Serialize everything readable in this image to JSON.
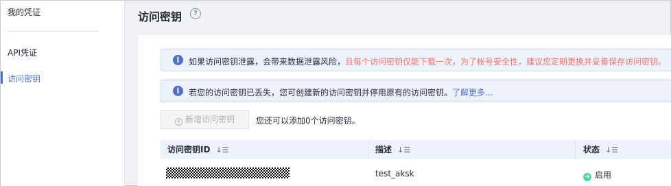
{
  "sidebar": {
    "title": "我的凭证",
    "items": [
      {
        "label": "API凭证"
      },
      {
        "label": "访问密钥"
      }
    ]
  },
  "header": {
    "title": "访问密钥",
    "help_glyph": "?"
  },
  "notices": [
    {
      "text_normal": "如果访问密钥泄露，会带来数据泄露风险，",
      "text_warning": "且每个访问密钥仅能下载一次，为了帐号安全性，建议您定期更换并妥善保存访问密钥。"
    },
    {
      "text_normal": "若您的访问密钥已丢失，您可创建新的访问密钥并停用原有的访问密钥。",
      "link": "了解更多..."
    }
  ],
  "toolbar": {
    "add_label": "新增访问密钥",
    "quota_text": "您还可以添加0个访问密钥。"
  },
  "table": {
    "columns": [
      {
        "label": "访问密钥ID"
      },
      {
        "label": "描述"
      },
      {
        "label": "状态"
      }
    ],
    "rows": [
      {
        "description": "test_aksk",
        "status": "启用"
      }
    ]
  },
  "icons": {
    "info": "info-icon",
    "sort": "sort-icon",
    "help": "question-circle-icon",
    "add": "plus-circle-icon",
    "status": "check-circle-icon"
  },
  "colors": {
    "accent": "#526ecc",
    "warning": "#f66f6a",
    "success": "#50d4ab",
    "notice_bg": "#edf2fb"
  }
}
